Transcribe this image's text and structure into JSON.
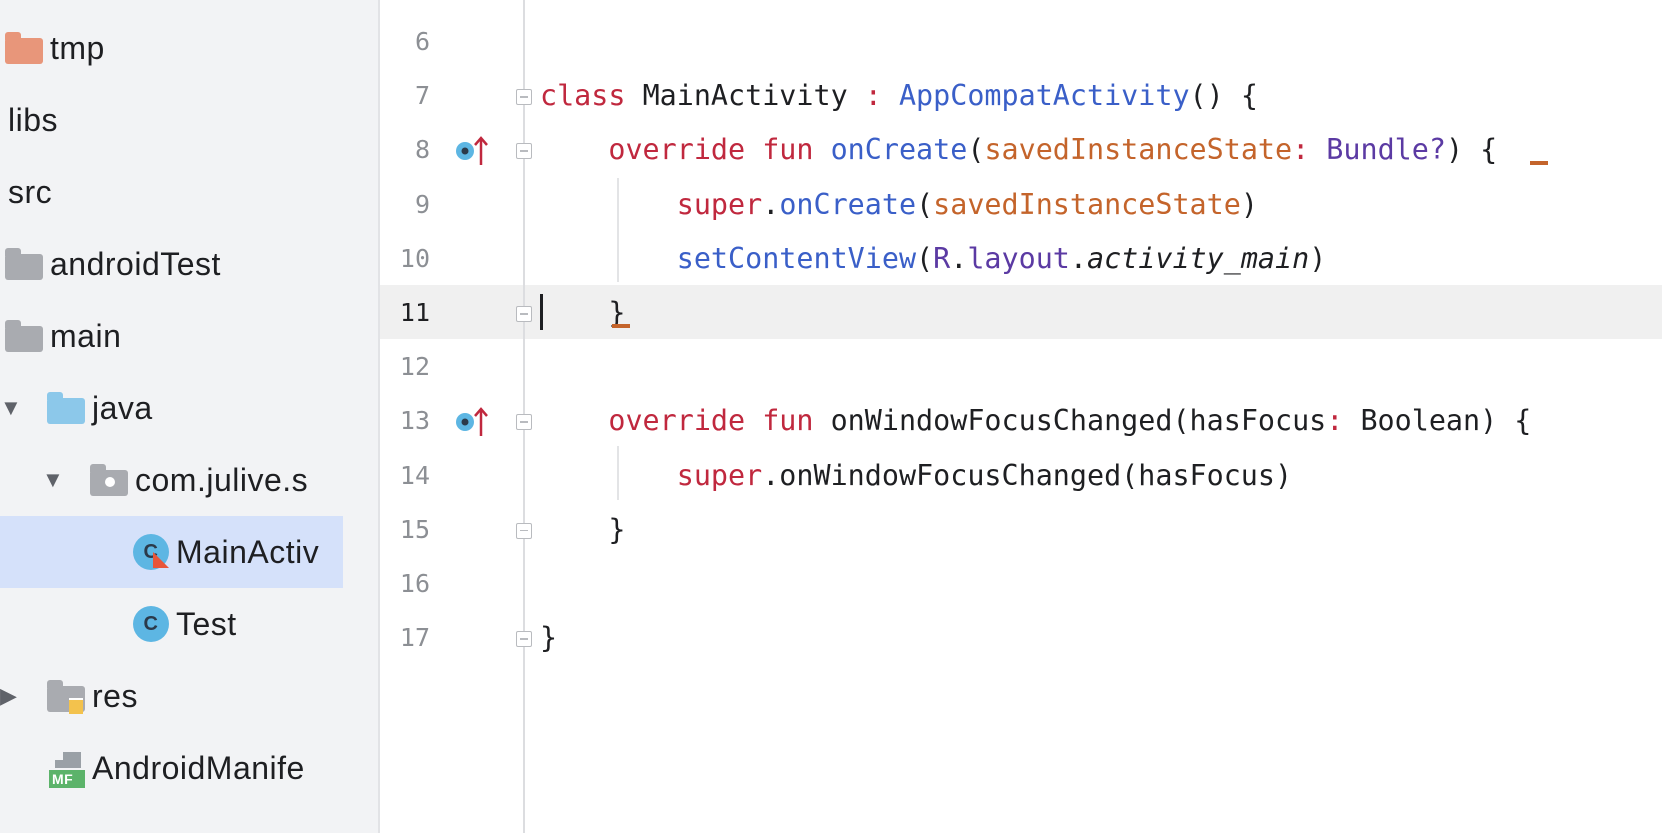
{
  "project_tree": {
    "items": [
      {
        "label": "tmp",
        "icon": "folder-icon",
        "indent": 1,
        "arrow": "",
        "selected": false
      },
      {
        "label": "libs",
        "icon": "",
        "indent": 0,
        "arrow": "",
        "selected": false
      },
      {
        "label": "src",
        "icon": "",
        "indent": 0,
        "arrow": "",
        "selected": false
      },
      {
        "label": "androidTest",
        "icon": "folder-icon",
        "indent": 1,
        "arrow": "",
        "selected": false
      },
      {
        "label": "main",
        "icon": "folder-icon",
        "indent": 1,
        "arrow": "",
        "selected": false
      },
      {
        "label": "java",
        "icon": "source-folder-icon",
        "indent": 2,
        "arrow": "▼",
        "selected": false
      },
      {
        "label": "com.julive.s",
        "icon": "package-icon",
        "indent": 3,
        "arrow": "▼",
        "selected": false
      },
      {
        "label": "MainActiv",
        "icon": "kotlin-class-icon",
        "indent": 4,
        "arrow": "",
        "selected": true
      },
      {
        "label": "Test",
        "icon": "class-icon",
        "indent": 4,
        "arrow": "",
        "selected": false
      },
      {
        "label": "res",
        "icon": "resource-folder-icon",
        "indent": 2,
        "arrow": "▶",
        "selected": false
      },
      {
        "label": "AndroidManife",
        "icon": "manifest-icon",
        "indent": 2,
        "arrow": "",
        "selected": false
      }
    ],
    "class_icon_letter": "C",
    "manifest_icon_text": "MF"
  },
  "editor": {
    "current_line": 11,
    "lines": [
      {
        "n": "6",
        "tokens": []
      },
      {
        "n": "7",
        "tokens": [
          {
            "t": "class ",
            "c": "kw"
          },
          {
            "t": "MainActivity ",
            "c": ""
          },
          {
            "t": ": ",
            "c": "kw"
          },
          {
            "t": "AppCompatActivity",
            "c": "fn"
          },
          {
            "t": "() {",
            "c": ""
          }
        ]
      },
      {
        "n": "8",
        "tokens": [
          {
            "t": "    ",
            "c": ""
          },
          {
            "t": "override ",
            "c": "kw"
          },
          {
            "t": "fun ",
            "c": "kw"
          },
          {
            "t": "onCreate",
            "c": "fn"
          },
          {
            "t": "(",
            "c": ""
          },
          {
            "t": "savedInstanceState",
            "c": "prm"
          },
          {
            "t": ": ",
            "c": "kw"
          },
          {
            "t": "Bundle?",
            "c": "typ"
          },
          {
            "t": ") ",
            "c": ""
          },
          {
            "t": "{",
            "c": ""
          }
        ]
      },
      {
        "n": "9",
        "tokens": [
          {
            "t": "        ",
            "c": ""
          },
          {
            "t": "super",
            "c": "kw"
          },
          {
            "t": ".",
            "c": ""
          },
          {
            "t": "onCreate",
            "c": "fn"
          },
          {
            "t": "(",
            "c": ""
          },
          {
            "t": "savedInstanceState",
            "c": "prm"
          },
          {
            "t": ")",
            "c": ""
          }
        ]
      },
      {
        "n": "10",
        "tokens": [
          {
            "t": "        ",
            "c": ""
          },
          {
            "t": "setContentView",
            "c": "fn"
          },
          {
            "t": "(",
            "c": ""
          },
          {
            "t": "R",
            "c": "typ"
          },
          {
            "t": ".",
            "c": ""
          },
          {
            "t": "layout",
            "c": "typ"
          },
          {
            "t": ".",
            "c": ""
          },
          {
            "t": "activity_main",
            "c": "it"
          },
          {
            "t": ")",
            "c": ""
          }
        ]
      },
      {
        "n": "11",
        "tokens": [
          {
            "t": "    ",
            "c": ""
          },
          {
            "t": "}",
            "c": ""
          }
        ]
      },
      {
        "n": "12",
        "tokens": []
      },
      {
        "n": "13",
        "tokens": [
          {
            "t": "    ",
            "c": ""
          },
          {
            "t": "override ",
            "c": "kw"
          },
          {
            "t": "fun ",
            "c": "kw"
          },
          {
            "t": "onWindowFocusChanged(hasFocus",
            "c": ""
          },
          {
            "t": ": ",
            "c": "kw"
          },
          {
            "t": "Boolean) {",
            "c": ""
          }
        ]
      },
      {
        "n": "14",
        "tokens": [
          {
            "t": "        ",
            "c": ""
          },
          {
            "t": "super",
            "c": "kw"
          },
          {
            "t": ".onWindowFocusChanged(hasFocus)",
            "c": ""
          }
        ]
      },
      {
        "n": "15",
        "tokens": [
          {
            "t": "    ",
            "c": ""
          },
          {
            "t": "}",
            "c": ""
          }
        ]
      },
      {
        "n": "16",
        "tokens": []
      },
      {
        "n": "17",
        "tokens": [
          {
            "t": "}",
            "c": ""
          }
        ]
      }
    ],
    "override_marker_lines": [
      "8",
      "13"
    ],
    "fold_marker_lines": [
      "7",
      "8",
      "11",
      "13",
      "15",
      "17"
    ]
  },
  "colors": {
    "keyword": "#c0283e",
    "function": "#3a5fc8",
    "parameter": "#c4642b",
    "type": "#5b3aa3",
    "selection": "#d5e1fa",
    "folder_orange": "#e8967a",
    "folder_gray": "#a9abb0",
    "folder_blue": "#8cc8ea",
    "override_icon": "#5db6e3",
    "override_arrow": "#c0283e"
  }
}
